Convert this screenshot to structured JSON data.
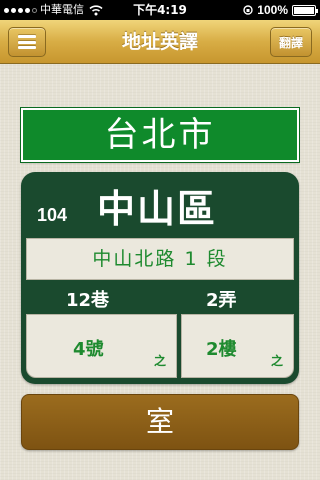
{
  "status_bar": {
    "carrier": "中華電信",
    "time": "下午4:19",
    "battery": "100%",
    "signal_bars": 4,
    "battery_level": 1.0
  },
  "nav": {
    "title": "地址英譯",
    "menu_icon": "hamburger-icon",
    "translate_label": "翻譯"
  },
  "address": {
    "city": "台北市",
    "zip": "104",
    "district": "中山區",
    "road": "中山北路 1 段",
    "lane": "12巷",
    "alley": "2弄",
    "number": "4號",
    "number_suffix": "之",
    "floor": "2樓",
    "floor_suffix": "之",
    "room": "室"
  },
  "colors": {
    "nav_gold": "#d8ad45",
    "city_green": "#0f8a2b",
    "panel_dark_green": "#1a4a2e",
    "text_green": "#1e8a2f",
    "room_brown": "#8a5e18",
    "background": "#e5e1d4"
  }
}
